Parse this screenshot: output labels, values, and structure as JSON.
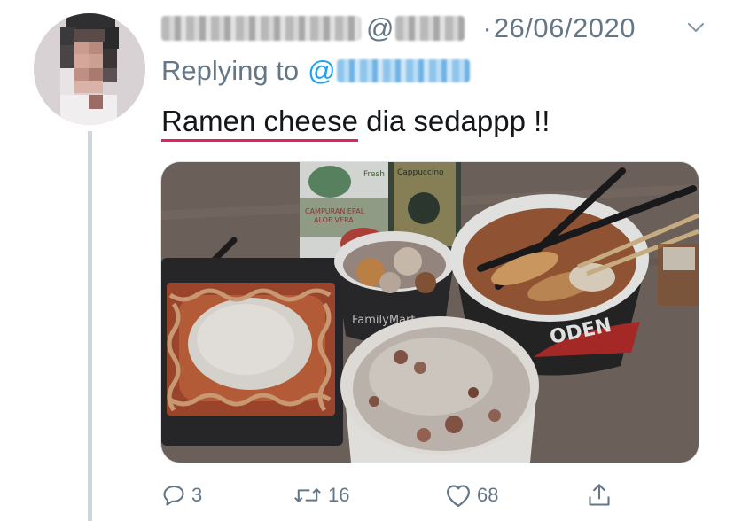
{
  "tweet": {
    "handle_prefix": "@",
    "separator": "·",
    "date": "26/06/2020",
    "replying_label": "Replying to",
    "replying_mention_prefix": "@",
    "text_underlined": "Ramen cheese",
    "text_rest": " dia sedappp !!"
  },
  "photo": {
    "carton_left_text": [
      "Fresh",
      "CAMPURAN EPAL",
      "ALOE VERA"
    ],
    "carton_right_text": "Cappuccino",
    "bowl_small_text": "FamilyMart",
    "bowl_large_text": "ODEN"
  },
  "actions": {
    "reply_count": "3",
    "retweet_count": "16",
    "like_count": "68"
  },
  "icons": {
    "reply": "reply-icon",
    "retweet": "retweet-icon",
    "like": "heart-icon",
    "share": "share-icon",
    "more": "chevron-down-icon"
  },
  "colors": {
    "secondary_text": "#657786",
    "mention": "#1da1f2",
    "underline": "#e0245e",
    "thread_line": "#ccd6dd"
  }
}
